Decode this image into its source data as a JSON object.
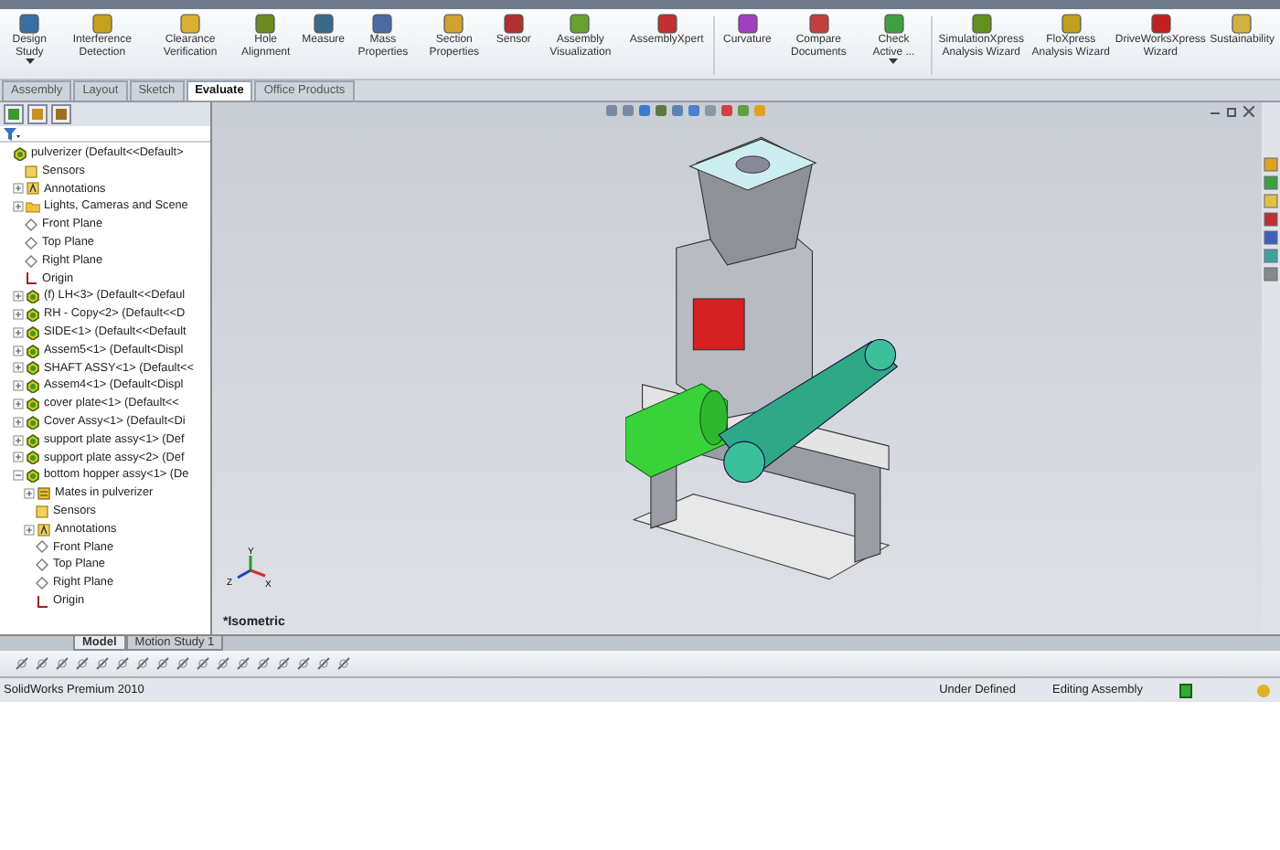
{
  "ribbon": {
    "buttons": [
      {
        "label": "Design Study",
        "dropdown": true
      },
      {
        "label": "Interference Detection",
        "dropdown": false
      },
      {
        "label": "Clearance Verification",
        "dropdown": false
      },
      {
        "label": "Hole Alignment",
        "dropdown": false
      },
      {
        "label": "Measure",
        "dropdown": false
      },
      {
        "label": "Mass Properties",
        "dropdown": false
      },
      {
        "label": "Section Properties",
        "dropdown": false
      },
      {
        "label": "Sensor",
        "dropdown": false
      },
      {
        "label": "Assembly Visualization",
        "dropdown": false
      },
      {
        "label": "AssemblyXpert",
        "dropdown": false
      },
      {
        "label": "Curvature",
        "dropdown": false
      },
      {
        "label": "Compare Documents",
        "dropdown": false
      },
      {
        "label": "Check Active ...",
        "dropdown": true
      },
      {
        "label": "SimulationXpress Analysis Wizard",
        "dropdown": false
      },
      {
        "label": "FloXpress Analysis Wizard",
        "dropdown": false
      },
      {
        "label": "DriveWorksXpress Wizard",
        "dropdown": false
      },
      {
        "label": "Sustainability",
        "dropdown": false
      }
    ]
  },
  "tabs": [
    {
      "label": "Assembly",
      "selected": false
    },
    {
      "label": "Layout",
      "selected": false
    },
    {
      "label": "Sketch",
      "selected": false
    },
    {
      "label": "Evaluate",
      "selected": true
    },
    {
      "label": "Office Products",
      "selected": false
    }
  ],
  "feature_tree": [
    {
      "label": "pulverizer  (Default<<Default>",
      "kind": "assembly",
      "children": [
        {
          "label": "Sensors",
          "kind": "sensor"
        },
        {
          "label": "Annotations",
          "kind": "annotation",
          "expanded": false
        },
        {
          "label": "Lights, Cameras and Scene",
          "kind": "folder",
          "expanded": false
        },
        {
          "label": "Front Plane",
          "kind": "plane"
        },
        {
          "label": "Top Plane",
          "kind": "plane"
        },
        {
          "label": "Right Plane",
          "kind": "plane"
        },
        {
          "label": "Origin",
          "kind": "origin"
        },
        {
          "label": "(f) LH<3> (Default<<Defaul",
          "kind": "assembly",
          "expanded": false
        },
        {
          "label": "RH - Copy<2> (Default<<D",
          "kind": "assembly",
          "expanded": false
        },
        {
          "label": "SIDE<1> (Default<<Default",
          "kind": "assembly",
          "expanded": false
        },
        {
          "label": "Assem5<1> (Default<Displ",
          "kind": "assembly",
          "expanded": false
        },
        {
          "label": "SHAFT ASSY<1> (Default<<",
          "kind": "assembly",
          "expanded": false
        },
        {
          "label": "Assem4<1> (Default<Displ",
          "kind": "assembly",
          "expanded": false
        },
        {
          "label": "cover plate<1> (Default<<",
          "kind": "assembly",
          "expanded": false
        },
        {
          "label": "Cover Assy<1> (Default<Di",
          "kind": "assembly",
          "expanded": false
        },
        {
          "label": "support plate assy<1> (Def",
          "kind": "assembly",
          "expanded": false
        },
        {
          "label": "support plate assy<2> (Def",
          "kind": "assembly",
          "expanded": false
        },
        {
          "label": "bottom hopper assy<1> (De",
          "kind": "assembly",
          "expanded": true,
          "children": [
            {
              "label": "Mates in pulverizer",
              "kind": "mates",
              "expanded": false
            },
            {
              "label": "Sensors",
              "kind": "sensor"
            },
            {
              "label": "Annotations",
              "kind": "annotation",
              "expanded": false
            },
            {
              "label": "Front Plane",
              "kind": "plane"
            },
            {
              "label": "Top Plane",
              "kind": "plane"
            },
            {
              "label": "Right Plane",
              "kind": "plane"
            },
            {
              "label": "Origin",
              "kind": "origin"
            }
          ]
        }
      ]
    }
  ],
  "viewport": {
    "view_label": "*Isometric",
    "triad": {
      "x": "X",
      "y": "Y",
      "z": "Z"
    }
  },
  "bottom_tabs": [
    {
      "label": "Model",
      "selected": true
    },
    {
      "label": "Motion Study 1",
      "selected": false
    }
  ],
  "status_bar": {
    "product": "SolidWorks Premium 2010",
    "fields": [
      "Under Defined",
      "Editing Assembly"
    ]
  }
}
